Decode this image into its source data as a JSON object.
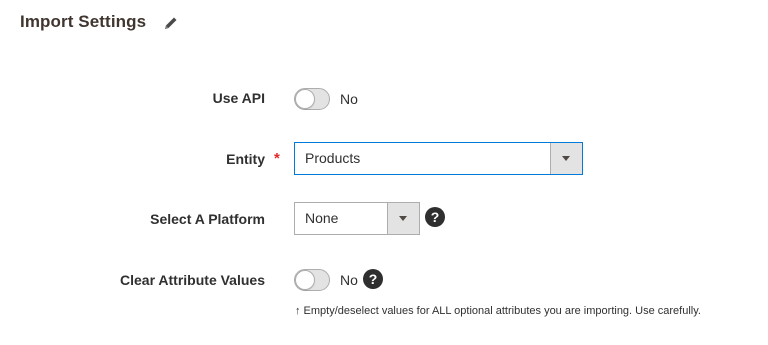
{
  "section": {
    "title": "Import Settings",
    "edit_icon": "pencil-icon"
  },
  "use_api": {
    "label": "Use API",
    "state": "No",
    "enabled": false
  },
  "entity": {
    "label": "Entity",
    "required_mark": "*",
    "selected": "Products"
  },
  "platform": {
    "label": "Select A Platform",
    "selected": "None",
    "help_icon": "question-icon",
    "help_glyph": "?"
  },
  "clear_attributes": {
    "label": "Clear Attribute Values",
    "state": "No",
    "enabled": false,
    "help_icon": "question-icon",
    "help_glyph": "?",
    "note": "↑ Empty/deselect values for ALL optional attributes you are importing. Use carefully."
  },
  "colors": {
    "focus_border": "#007bdb",
    "required": "#e22626",
    "title": "#41362f"
  }
}
